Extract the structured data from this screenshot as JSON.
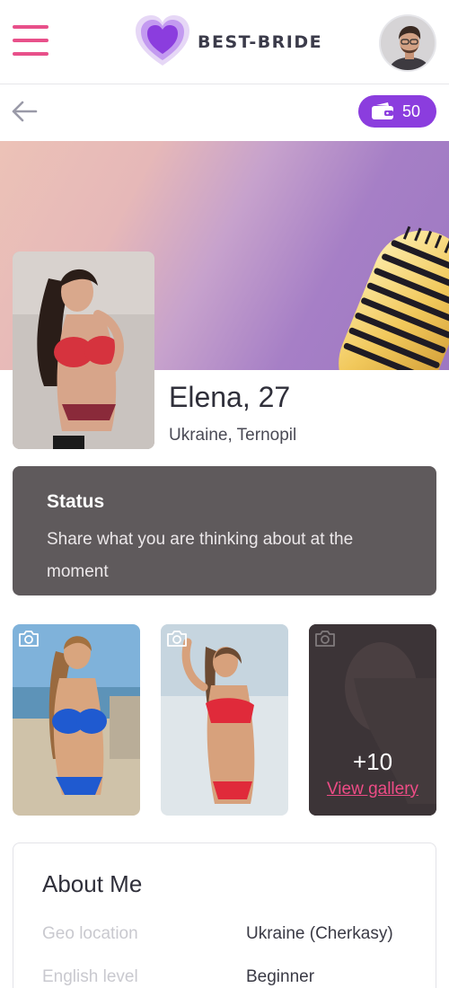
{
  "header": {
    "menu_icon": "hamburger-menu-icon",
    "logo_icon": "heart-icon",
    "brand": "BEST-BRIDE",
    "brand_color": "#8b3dde",
    "accent_color": "#e8508a"
  },
  "subbar": {
    "back_icon": "arrow-left-icon",
    "credits_icon": "wallet-icon",
    "credits": "50"
  },
  "profile": {
    "name_age": "Elena, 27",
    "location": "Ukraine, Ternopil"
  },
  "status": {
    "title": "Status",
    "text": "Share what you are thinking about at the moment"
  },
  "gallery": {
    "camera_icon": "camera-icon",
    "more_count": "+10",
    "view_label": "View gallery"
  },
  "about": {
    "title": "About Me",
    "rows": [
      {
        "label": "Geo location",
        "value": "Ukraine (Cherkasy)"
      },
      {
        "label": "English level",
        "value": "Beginner"
      }
    ]
  }
}
